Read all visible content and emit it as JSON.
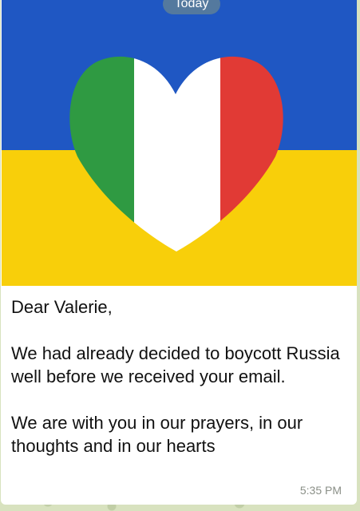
{
  "date_divider": "Today",
  "image": {
    "description_icon": "heart-icon",
    "flag_colors": {
      "blue": "#1f57c3",
      "yellow": "#f8cf0a"
    },
    "heart_colors": {
      "green": "#2f9a42",
      "white": "#ffffff",
      "red": "#e13a35"
    }
  },
  "message": {
    "greeting": "Dear Valerie,",
    "paragraph1": "We had already decided to boycott Russia well before we received your email.",
    "paragraph2": "We are with you in our prayers, in our thoughts and in our hearts",
    "time": "5:35 PM"
  }
}
